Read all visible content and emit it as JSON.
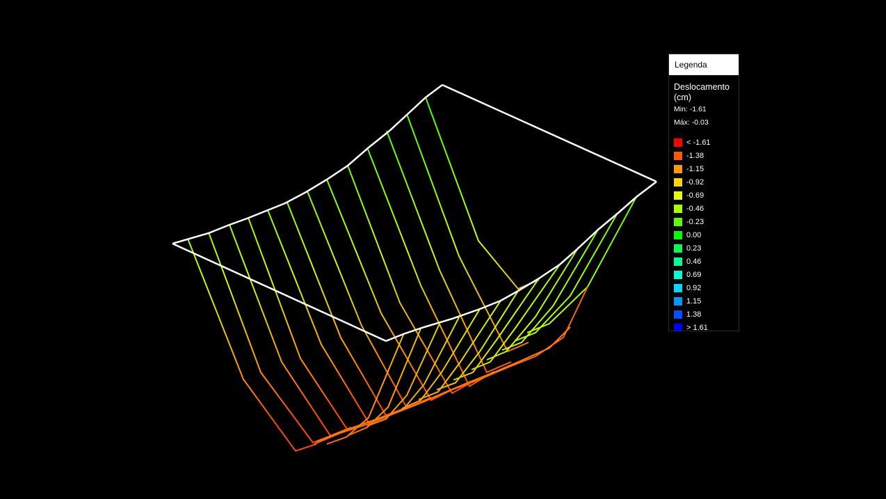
{
  "legend": {
    "title": "Legenda",
    "quantity": "Deslocamento",
    "unit": "(cm)",
    "min_label": "Min:",
    "min_value": "-1.61",
    "max_label": "Máx:",
    "max_value": "-0.03",
    "scale": [
      {
        "label": "< -1.61",
        "color": "#ff0000"
      },
      {
        "label": "-1.38",
        "color": "#ff5a00"
      },
      {
        "label": "-1.15",
        "color": "#ff9a00"
      },
      {
        "label": "-0.92",
        "color": "#ffd400"
      },
      {
        "label": "-0.69",
        "color": "#e8ff00"
      },
      {
        "label": "-0.46",
        "color": "#a6ff00"
      },
      {
        "label": "-0.23",
        "color": "#5cff00"
      },
      {
        "label": "0.00",
        "color": "#00ff00"
      },
      {
        "label": "0.23",
        "color": "#00ff55"
      },
      {
        "label": "0.46",
        "color": "#00ff9a"
      },
      {
        "label": "0.69",
        "color": "#00ffd8"
      },
      {
        "label": "0.92",
        "color": "#00d8ff"
      },
      {
        "label": "1.15",
        "color": "#0096ff"
      },
      {
        "label": "1.38",
        "color": "#0050ff"
      },
      {
        "label": "> 1.61",
        "color": "#0000ff"
      }
    ]
  },
  "viewport": {
    "background": "#000000",
    "undeformed_outline_color": "#ffffff"
  }
}
